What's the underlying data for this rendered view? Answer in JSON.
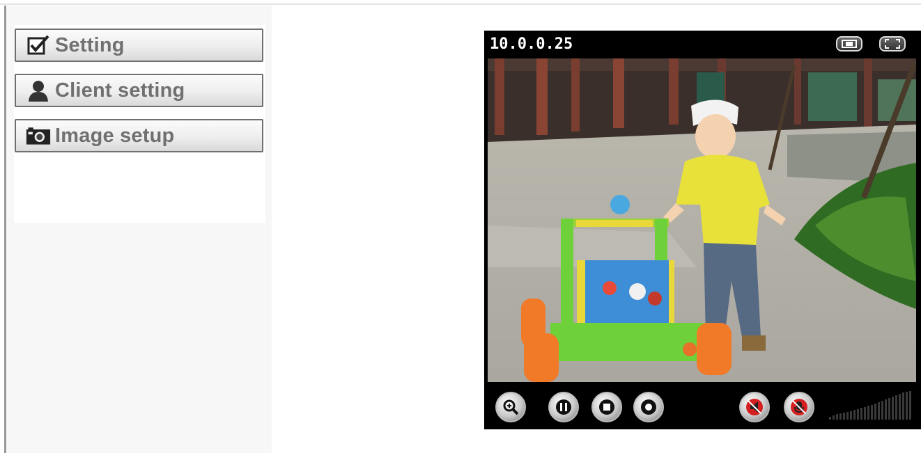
{
  "sidebar": {
    "items": [
      {
        "label": "Setting",
        "icon": "checkbox-icon"
      },
      {
        "label": "Client setting",
        "icon": "user-icon"
      },
      {
        "label": "Image setup",
        "icon": "camera-icon"
      }
    ]
  },
  "viewer": {
    "camera_ip": "10.0.0.25",
    "title_buttons": [
      "window-size-icon",
      "fullscreen-icon"
    ],
    "controls": [
      "zoom-icon",
      "pause-icon",
      "stop-icon",
      "record-icon",
      "speaker-muted-icon",
      "microphone-muted-icon",
      "volume-level-icon"
    ]
  },
  "colors": {
    "button_text": "#707070",
    "viewer_bg": "#000000",
    "muted_red": "#d42020"
  }
}
